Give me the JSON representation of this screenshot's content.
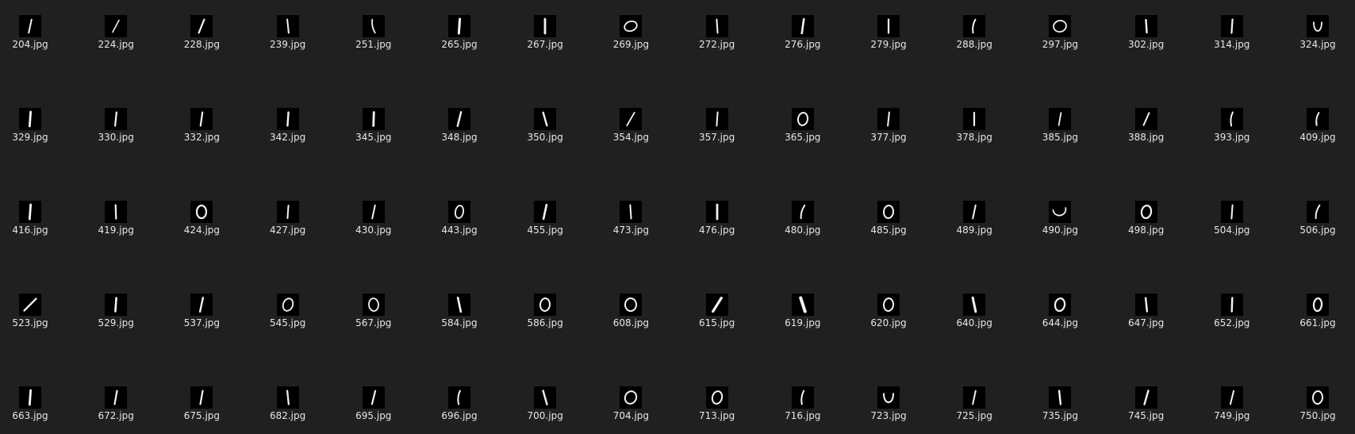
{
  "files": [
    {
      "name": "204.jpg",
      "digit": "one",
      "shape": {
        "tilt": 12,
        "len": 17,
        "w": 2.0
      }
    },
    {
      "name": "224.jpg",
      "digit": "one",
      "shape": {
        "tilt": 28,
        "len": 17,
        "w": 1.6
      }
    },
    {
      "name": "228.jpg",
      "digit": "one",
      "shape": {
        "tilt": 22,
        "len": 18,
        "w": 2.2
      }
    },
    {
      "name": "239.jpg",
      "digit": "one",
      "shape": {
        "tilt": -6,
        "len": 17,
        "w": 2.0
      }
    },
    {
      "name": "251.jpg",
      "digit": "one",
      "shape": {
        "tilt": -12,
        "len": 17,
        "w": 1.8,
        "curve": true
      }
    },
    {
      "name": "265.jpg",
      "digit": "one",
      "shape": {
        "tilt": 4,
        "len": 18,
        "w": 3.0
      }
    },
    {
      "name": "267.jpg",
      "digit": "one",
      "shape": {
        "tilt": 0,
        "len": 18,
        "w": 2.8
      }
    },
    {
      "name": "269.jpg",
      "digit": "zero",
      "shape": {
        "rx": 8,
        "ry": 6,
        "rot": -20,
        "w": 1.8
      }
    },
    {
      "name": "272.jpg",
      "digit": "one",
      "shape": {
        "tilt": -4,
        "len": 17,
        "w": 2.0
      }
    },
    {
      "name": "276.jpg",
      "digit": "one",
      "shape": {
        "tilt": 8,
        "len": 18,
        "w": 2.6
      }
    },
    {
      "name": "279.jpg",
      "digit": "one",
      "shape": {
        "tilt": 0,
        "len": 17,
        "w": 2.2
      }
    },
    {
      "name": "288.jpg",
      "digit": "one",
      "shape": {
        "tilt": 10,
        "len": 17,
        "w": 2.0,
        "curve": true
      }
    },
    {
      "name": "297.jpg",
      "digit": "zero",
      "shape": {
        "rx": 8,
        "ry": 7,
        "rot": -15,
        "w": 1.8
      }
    },
    {
      "name": "302.jpg",
      "digit": "one",
      "shape": {
        "tilt": -4,
        "len": 16,
        "w": 2.4
      }
    },
    {
      "name": "314.jpg",
      "digit": "one",
      "shape": {
        "tilt": 4,
        "len": 17,
        "w": 2.2
      }
    },
    {
      "name": "324.jpg",
      "digit": "zero",
      "shape": {
        "rx": 5,
        "ry": 8,
        "rot": 0,
        "w": 1.8,
        "open": true
      }
    },
    {
      "name": "329.jpg",
      "digit": "one",
      "shape": {
        "tilt": 4,
        "len": 18,
        "w": 2.8
      }
    },
    {
      "name": "330.jpg",
      "digit": "one",
      "shape": {
        "tilt": 6,
        "len": 17,
        "w": 2.2
      }
    },
    {
      "name": "332.jpg",
      "digit": "one",
      "shape": {
        "tilt": 8,
        "len": 17,
        "w": 2.2
      }
    },
    {
      "name": "342.jpg",
      "digit": "one",
      "shape": {
        "tilt": 4,
        "len": 17,
        "w": 2.4
      }
    },
    {
      "name": "345.jpg",
      "digit": "one",
      "shape": {
        "tilt": 2,
        "len": 17,
        "w": 2.8
      }
    },
    {
      "name": "348.jpg",
      "digit": "one",
      "shape": {
        "tilt": 14,
        "len": 18,
        "w": 2.4
      }
    },
    {
      "name": "350.jpg",
      "digit": "one",
      "shape": {
        "tilt": -16,
        "len": 17,
        "w": 2.4
      }
    },
    {
      "name": "354.jpg",
      "digit": "one",
      "shape": {
        "tilt": 30,
        "len": 19,
        "w": 1.8
      }
    },
    {
      "name": "357.jpg",
      "digit": "one",
      "shape": {
        "tilt": 4,
        "len": 17,
        "w": 2.0
      }
    },
    {
      "name": "365.jpg",
      "digit": "zero",
      "shape": {
        "rx": 6,
        "ry": 8,
        "rot": 10,
        "w": 2.0
      }
    },
    {
      "name": "377.jpg",
      "digit": "one",
      "shape": {
        "tilt": 6,
        "len": 17,
        "w": 2.0
      }
    },
    {
      "name": "378.jpg",
      "digit": "one",
      "shape": {
        "tilt": 0,
        "len": 16,
        "w": 2.2
      }
    },
    {
      "name": "385.jpg",
      "digit": "one",
      "shape": {
        "tilt": 10,
        "len": 16,
        "w": 1.8
      }
    },
    {
      "name": "388.jpg",
      "digit": "one",
      "shape": {
        "tilt": 24,
        "len": 17,
        "w": 2.0
      }
    },
    {
      "name": "393.jpg",
      "digit": "one",
      "shape": {
        "tilt": 6,
        "len": 17,
        "w": 2.0,
        "curve": true
      }
    },
    {
      "name": "409.jpg",
      "digit": "one",
      "shape": {
        "tilt": 10,
        "len": 16,
        "w": 2.0,
        "curve": true
      }
    },
    {
      "name": "416.jpg",
      "digit": "one",
      "shape": {
        "tilt": 4,
        "len": 18,
        "w": 2.8
      }
    },
    {
      "name": "419.jpg",
      "digit": "one",
      "shape": {
        "tilt": -2,
        "len": 17,
        "w": 2.2
      }
    },
    {
      "name": "424.jpg",
      "digit": "zero",
      "shape": {
        "rx": 6,
        "ry": 8,
        "rot": 0,
        "w": 2.2
      }
    },
    {
      "name": "427.jpg",
      "digit": "one",
      "shape": {
        "tilt": 4,
        "len": 16,
        "w": 2.0
      }
    },
    {
      "name": "430.jpg",
      "digit": "one",
      "shape": {
        "tilt": 12,
        "len": 17,
        "w": 2.0
      }
    },
    {
      "name": "443.jpg",
      "digit": "zero",
      "shape": {
        "rx": 5,
        "ry": 8,
        "rot": 10,
        "w": 1.8
      }
    },
    {
      "name": "455.jpg",
      "digit": "one",
      "shape": {
        "tilt": 12,
        "len": 18,
        "w": 2.6
      }
    },
    {
      "name": "473.jpg",
      "digit": "one",
      "shape": {
        "tilt": -4,
        "len": 17,
        "w": 2.0
      }
    },
    {
      "name": "476.jpg",
      "digit": "one",
      "shape": {
        "tilt": 0,
        "len": 18,
        "w": 2.8
      }
    },
    {
      "name": "480.jpg",
      "digit": "one",
      "shape": {
        "tilt": 16,
        "len": 17,
        "w": 2.0,
        "curve": true
      }
    },
    {
      "name": "485.jpg",
      "digit": "zero",
      "shape": {
        "rx": 6,
        "ry": 8,
        "rot": 5,
        "w": 2.0
      }
    },
    {
      "name": "489.jpg",
      "digit": "one",
      "shape": {
        "tilt": 12,
        "len": 17,
        "w": 2.0
      }
    },
    {
      "name": "490.jpg",
      "digit": "zero",
      "shape": {
        "rx": 8,
        "ry": 6,
        "rot": -10,
        "w": 1.8,
        "open": true
      }
    },
    {
      "name": "498.jpg",
      "digit": "zero",
      "shape": {
        "rx": 6,
        "ry": 8,
        "rot": 10,
        "w": 2.2
      }
    },
    {
      "name": "504.jpg",
      "digit": "one",
      "shape": {
        "tilt": 4,
        "len": 17,
        "w": 2.0
      }
    },
    {
      "name": "506.jpg",
      "digit": "one",
      "shape": {
        "tilt": 16,
        "len": 17,
        "w": 2.0,
        "curve": true
      }
    },
    {
      "name": "523.jpg",
      "digit": "one",
      "shape": {
        "tilt": 45,
        "len": 21,
        "w": 2.4
      }
    },
    {
      "name": "529.jpg",
      "digit": "one",
      "shape": {
        "tilt": 4,
        "len": 17,
        "w": 2.6
      }
    },
    {
      "name": "537.jpg",
      "digit": "one",
      "shape": {
        "tilt": 12,
        "len": 18,
        "w": 2.4
      }
    },
    {
      "name": "545.jpg",
      "digit": "zero",
      "shape": {
        "rx": 6,
        "ry": 8,
        "rot": 20,
        "w": 1.8
      }
    },
    {
      "name": "567.jpg",
      "digit": "zero",
      "shape": {
        "rx": 6,
        "ry": 8,
        "rot": -5,
        "w": 1.8
      }
    },
    {
      "name": "584.jpg",
      "digit": "one",
      "shape": {
        "tilt": -12,
        "len": 18,
        "w": 2.6
      }
    },
    {
      "name": "586.jpg",
      "digit": "zero",
      "shape": {
        "rx": 6,
        "ry": 8,
        "rot": 5,
        "w": 2.0
      }
    },
    {
      "name": "608.jpg",
      "digit": "zero",
      "shape": {
        "rx": 7,
        "ry": 8,
        "rot": 0,
        "w": 2.0
      }
    },
    {
      "name": "615.jpg",
      "digit": "one",
      "shape": {
        "tilt": 32,
        "len": 20,
        "w": 3.2
      }
    },
    {
      "name": "619.jpg",
      "digit": "one",
      "shape": {
        "tilt": -18,
        "len": 18,
        "w": 4.0
      }
    },
    {
      "name": "620.jpg",
      "digit": "zero",
      "shape": {
        "rx": 6,
        "ry": 8,
        "rot": 5,
        "w": 2.0
      }
    },
    {
      "name": "640.jpg",
      "digit": "one",
      "shape": {
        "tilt": -12,
        "len": 18,
        "w": 3.0
      }
    },
    {
      "name": "644.jpg",
      "digit": "zero",
      "shape": {
        "rx": 6,
        "ry": 8,
        "rot": 10,
        "w": 2.2
      }
    },
    {
      "name": "647.jpg",
      "digit": "one",
      "shape": {
        "tilt": -6,
        "len": 17,
        "w": 2.4
      }
    },
    {
      "name": "652.jpg",
      "digit": "one",
      "shape": {
        "tilt": 2,
        "len": 17,
        "w": 2.4
      }
    },
    {
      "name": "661.jpg",
      "digit": "zero",
      "shape": {
        "rx": 5,
        "ry": 8,
        "rot": 5,
        "w": 2.2
      }
    },
    {
      "name": "663.jpg",
      "digit": "one",
      "shape": {
        "tilt": 4,
        "len": 18,
        "w": 2.8
      }
    },
    {
      "name": "672.jpg",
      "digit": "one",
      "shape": {
        "tilt": 10,
        "len": 17,
        "w": 2.2
      }
    },
    {
      "name": "675.jpg",
      "digit": "one",
      "shape": {
        "tilt": 10,
        "len": 17,
        "w": 2.2
      }
    },
    {
      "name": "682.jpg",
      "digit": "one",
      "shape": {
        "tilt": -6,
        "len": 17,
        "w": 2.2
      }
    },
    {
      "name": "695.jpg",
      "digit": "one",
      "shape": {
        "tilt": 14,
        "len": 17,
        "w": 2.2
      }
    },
    {
      "name": "696.jpg",
      "digit": "one",
      "shape": {
        "tilt": 6,
        "len": 17,
        "w": 2.0,
        "curve": true
      }
    },
    {
      "name": "700.jpg",
      "digit": "one",
      "shape": {
        "tilt": -16,
        "len": 18,
        "w": 2.4
      }
    },
    {
      "name": "704.jpg",
      "digit": "zero",
      "shape": {
        "rx": 7,
        "ry": 8,
        "rot": 25,
        "w": 2.0
      }
    },
    {
      "name": "713.jpg",
      "digit": "zero",
      "shape": {
        "rx": 6,
        "ry": 8,
        "rot": 15,
        "w": 2.0
      }
    },
    {
      "name": "716.jpg",
      "digit": "one",
      "shape": {
        "tilt": 8,
        "len": 17,
        "w": 2.0,
        "curve": true
      }
    },
    {
      "name": "723.jpg",
      "digit": "zero",
      "shape": {
        "rx": 6,
        "ry": 8,
        "rot": 0,
        "w": 2.0,
        "open": true
      }
    },
    {
      "name": "725.jpg",
      "digit": "one",
      "shape": {
        "tilt": 12,
        "len": 17,
        "w": 2.0
      }
    },
    {
      "name": "735.jpg",
      "digit": "one",
      "shape": {
        "tilt": -6,
        "len": 17,
        "w": 2.4
      }
    },
    {
      "name": "745.jpg",
      "digit": "one",
      "shape": {
        "tilt": 16,
        "len": 18,
        "w": 2.4
      }
    },
    {
      "name": "749.jpg",
      "digit": "one",
      "shape": {
        "tilt": 14,
        "len": 17,
        "w": 2.0
      }
    },
    {
      "name": "750.jpg",
      "digit": "zero",
      "shape": {
        "rx": 6,
        "ry": 8,
        "rot": 5,
        "w": 2.0
      }
    }
  ],
  "colors": {
    "background": "#202020",
    "thumbnail_bg": "#000000",
    "stroke": "#f2f2f2",
    "label": "#e6e6e6"
  }
}
